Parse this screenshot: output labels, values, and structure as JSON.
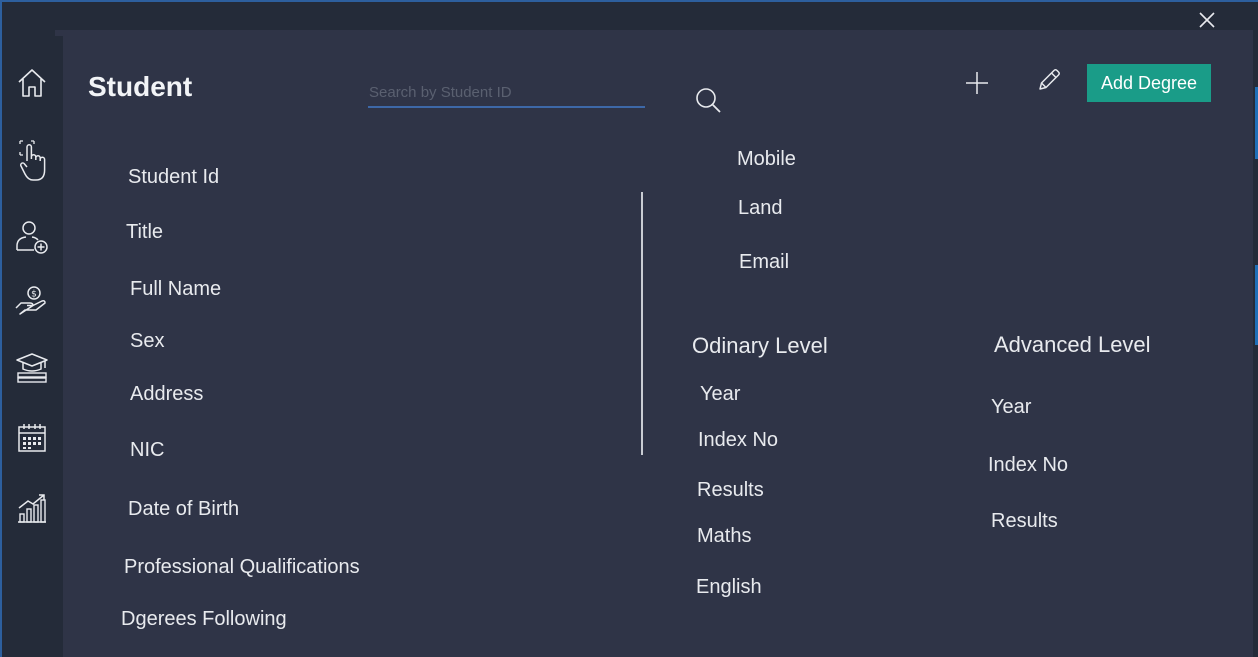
{
  "header": {
    "title": "Student",
    "search": {
      "placeholder": "Search by Student ID",
      "value": ""
    },
    "add_degree_label": "Add Degree"
  },
  "sidebar": {
    "items": [
      {
        "name": "home",
        "icon": "home-icon"
      },
      {
        "name": "touch",
        "icon": "touch-icon"
      },
      {
        "name": "add-user",
        "icon": "add-user-icon"
      },
      {
        "name": "payments",
        "icon": "money-hand-icon"
      },
      {
        "name": "degrees",
        "icon": "graduation-icon"
      },
      {
        "name": "calendar",
        "icon": "calendar-icon"
      },
      {
        "name": "reports",
        "icon": "chart-icon"
      }
    ]
  },
  "personal": {
    "student_id": "Student Id",
    "title": "Title",
    "full_name": "Full Name",
    "sex": "Sex",
    "address": "Address",
    "nic": "NIC",
    "dob": "Date of Birth",
    "professional_qualifications": "Professional Qualifications",
    "degrees_following": "Dgerees Following"
  },
  "contact": {
    "mobile": "Mobile",
    "land": "Land",
    "email": "Email"
  },
  "ordinary_level": {
    "heading": "Odinary Level",
    "year": "Year",
    "index_no": "Index No",
    "results": "Results",
    "maths": "Maths",
    "english": "English"
  },
  "advanced_level": {
    "heading": "Advanced Level",
    "year": "Year",
    "index_no": "Index No",
    "results": "Results"
  },
  "colors": {
    "background": "#242b39",
    "panel": "#2f3447",
    "accent": "#1a9c88",
    "input_underline": "#3d68a8"
  }
}
